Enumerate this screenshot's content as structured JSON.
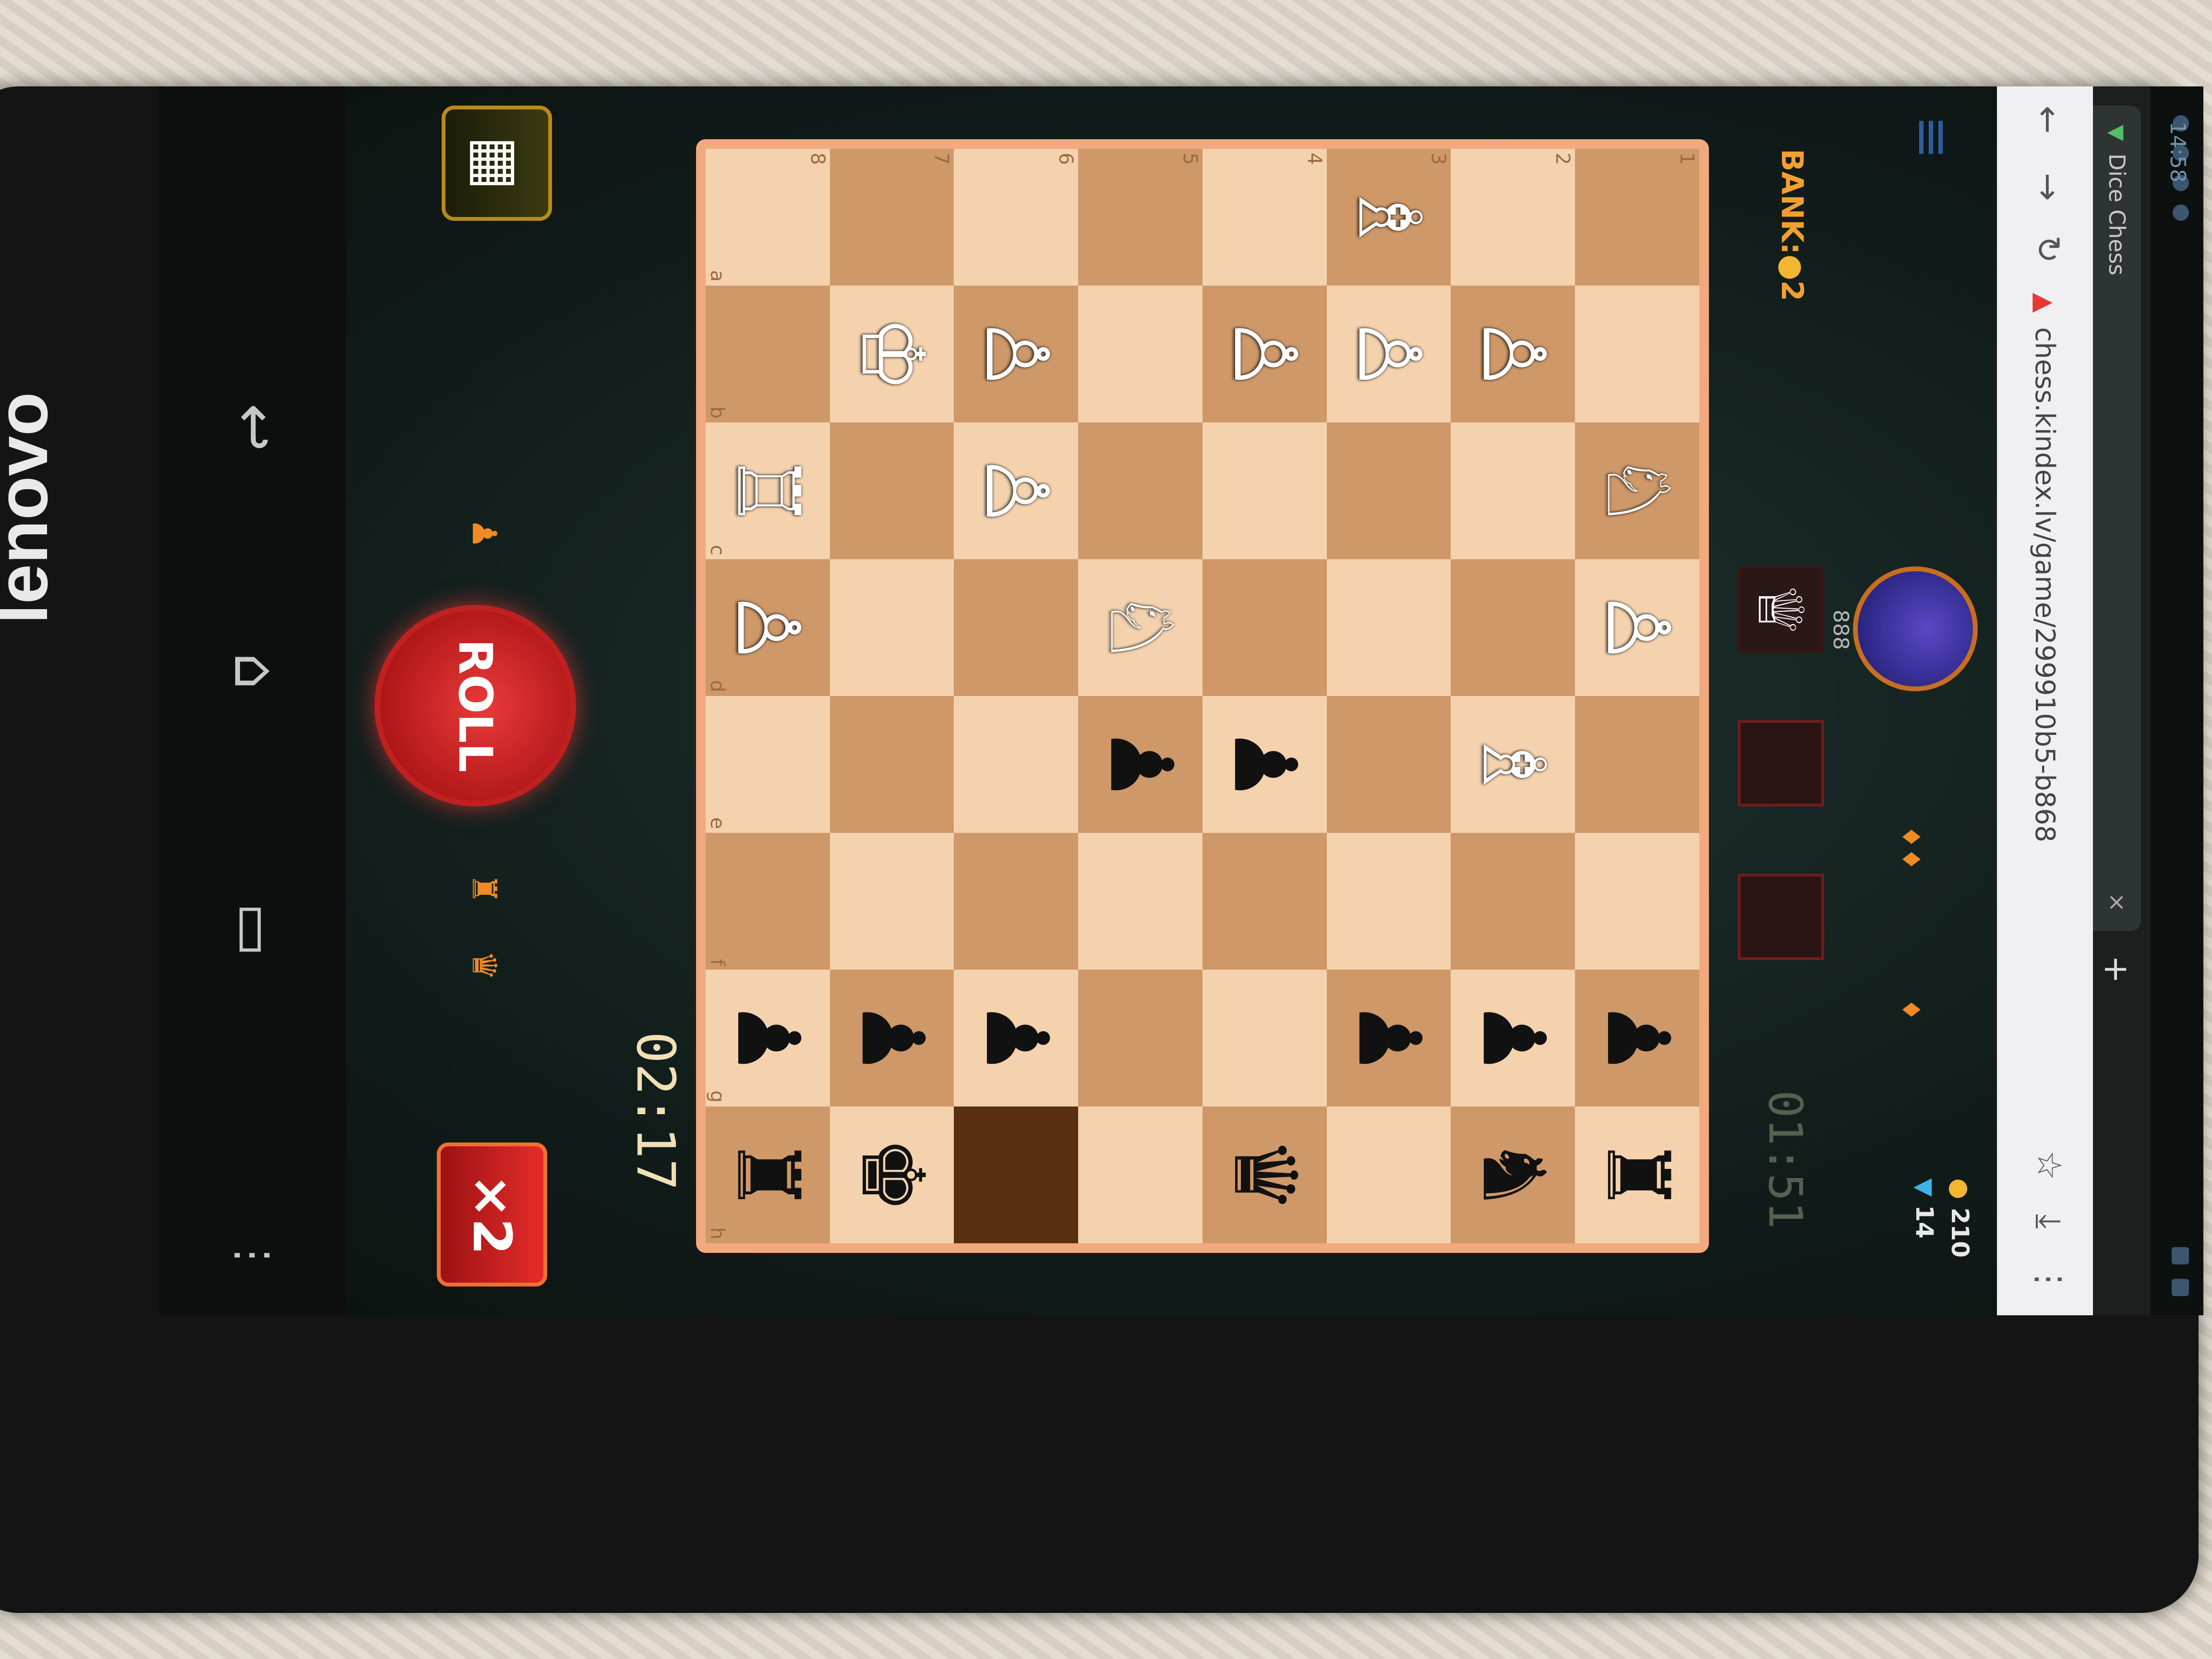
{
  "device": {
    "brand": "lenovo"
  },
  "status_bar": {
    "time": "14:58"
  },
  "browser": {
    "tab_title": "Dice Chess",
    "url": "chess.kindex.lv/game/299910b5-b868",
    "new_tab_glyph": "+",
    "close_glyph": "×"
  },
  "game": {
    "opponent_rating": "888",
    "coins": "210",
    "gems": "14",
    "bank_label": "BANK:",
    "bank_value": "2",
    "opponent_timer": "01:51",
    "my_timer": "02:17",
    "roll_label": "ROLL",
    "multiplier": "×2"
  },
  "board": {
    "ranks": [
      "1",
      "2",
      "3",
      "4",
      "5",
      "6",
      "7",
      "8"
    ],
    "files": [
      "a",
      "b",
      "c",
      "d",
      "e",
      "f",
      "g",
      "h"
    ],
    "rows": [
      [
        "",
        "",
        "♘",
        "♙",
        "",
        "",
        "♟",
        "♜"
      ],
      [
        "",
        "♙",
        "",
        "",
        "♗",
        "",
        "♟",
        "♞"
      ],
      [
        "♗",
        "♙",
        "",
        "",
        "",
        "",
        "♟",
        ""
      ],
      [
        "",
        "♙",
        "",
        "",
        "♟",
        "",
        "",
        "♛"
      ],
      [
        "",
        "",
        "",
        "♘",
        "♟",
        "",
        "",
        ""
      ],
      [
        "",
        "♙",
        "♙",
        "",
        "",
        "",
        "♟",
        ""
      ],
      [
        "",
        "♔",
        "",
        "",
        "",
        "",
        "♟",
        "♚"
      ],
      [
        "",
        "",
        "♖",
        "♙",
        "",
        "",
        "♟",
        "♜"
      ]
    ]
  },
  "colors": {
    "accent": "#e52b2b",
    "bank": "#f0a030",
    "board_light": "#f4d2ae",
    "board_dark": "#cf9868"
  }
}
